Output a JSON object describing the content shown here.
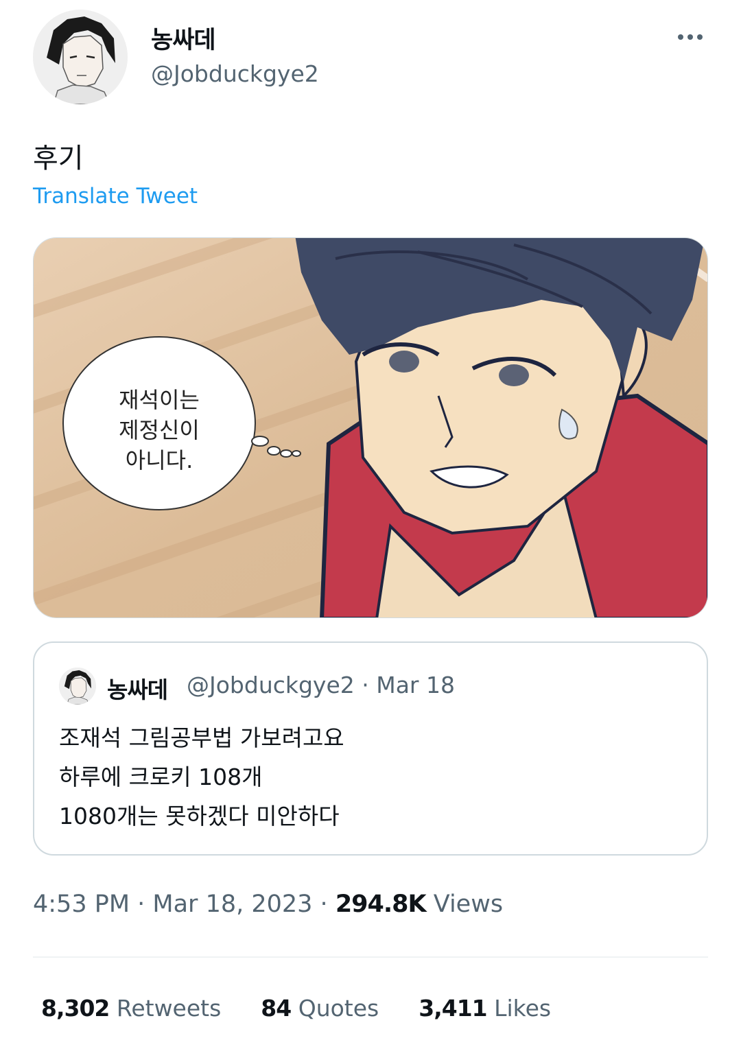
{
  "author": {
    "display_name": "농싸데",
    "handle": "@Jobduckgye2"
  },
  "tweet": {
    "text": "후기",
    "translate_label": "Translate Tweet",
    "image": {
      "bubble_lines": [
        "재석이는",
        "제정신이",
        "아니다."
      ]
    }
  },
  "quoted_tweet": {
    "display_name": "농싸데",
    "meta": "@Jobduckgye2 · Mar 18",
    "lines": [
      "조재석 그림공부법 가보려고요",
      "하루에 크로키 108개",
      "1080개는 못하겠다 미안하다"
    ]
  },
  "timestamp": {
    "time_date": "4:53 PM · Mar 18, 2023 · ",
    "views_count": "294.8K",
    "views_label": " Views"
  },
  "stats": {
    "retweets_count": "8,302",
    "retweets_label": " Retweets",
    "quotes_count": "84",
    "quotes_label": " Quotes",
    "likes_count": "3,411",
    "likes_label": " Likes"
  },
  "colors": {
    "link_blue": "#1d9bf0",
    "secondary_text": "#536471",
    "primary_text": "#0f1419",
    "border": "#cfd9de"
  }
}
